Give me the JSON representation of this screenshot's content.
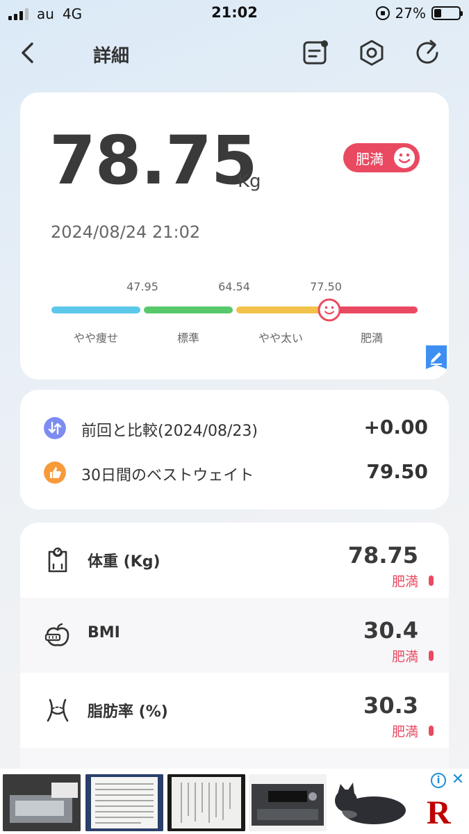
{
  "status_bar": {
    "carrier": "au",
    "network": "4G",
    "time": "21:02",
    "battery": "27%"
  },
  "nav": {
    "title": "詳細",
    "icons": [
      "back-arrow",
      "notes",
      "hexagon-settings",
      "refresh-share"
    ]
  },
  "summary": {
    "weight": "78.75",
    "unit": "Kg",
    "status": "肥満",
    "datetime": "2024/08/24 21:02",
    "thresholds": [
      "47.95",
      "64.54",
      "77.50"
    ],
    "segments": [
      {
        "label": "やや痩せ",
        "color": "#5cc8ea"
      },
      {
        "label": "標準",
        "color": "#57c96a"
      },
      {
        "label": "やや太い",
        "color": "#f2c24a"
      },
      {
        "label": "肥満",
        "color": "#e94a61"
      }
    ]
  },
  "compare": [
    {
      "label": "前回と比較(2024/08/23)",
      "value": "+0.00",
      "icon": "compare-icon",
      "color": "#7d8cf0"
    },
    {
      "label": "30日間のベストウェイト",
      "value": "79.50",
      "icon": "thumbs-up-icon",
      "color": "#f79a3a"
    }
  ],
  "metrics": [
    {
      "label": "体重 (Kg)",
      "value": "78.75",
      "status": "肥満"
    },
    {
      "label": "BMI",
      "value": "30.4",
      "status": "肥満"
    },
    {
      "label": "脂肪率 (%)",
      "value": "30.3",
      "status": "肥満"
    }
  ],
  "colors": {
    "accent_red": "#e94a61",
    "text_dark": "#3a3a3a"
  }
}
